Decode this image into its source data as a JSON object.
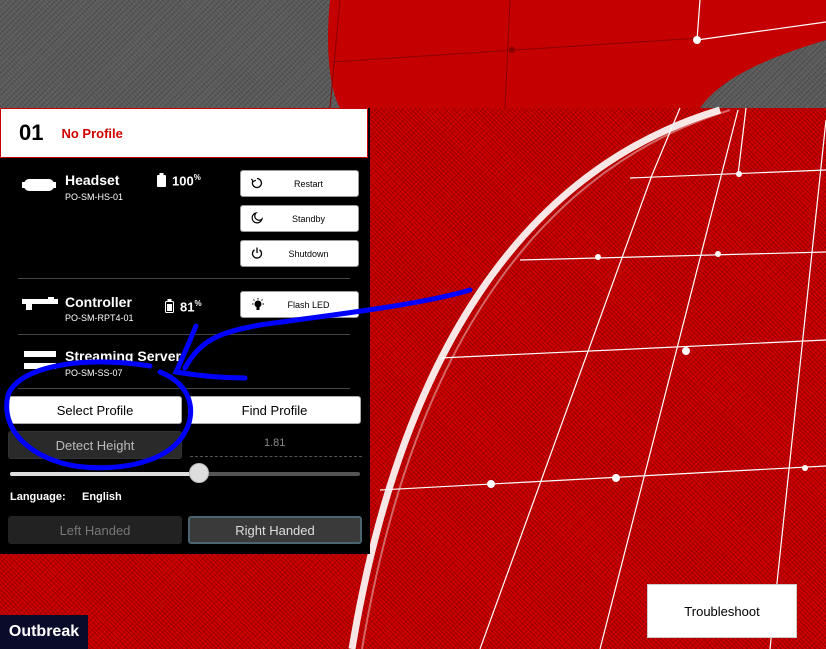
{
  "profile": {
    "number": "01",
    "name": "No Profile"
  },
  "devices": {
    "headset": {
      "name": "Headset",
      "id": "PO-SM-HS-01",
      "battery": "100",
      "battery_unit": "%"
    },
    "controller": {
      "name": "Controller",
      "id": "PO-SM-RPT4-01",
      "battery": "81",
      "battery_unit": "%"
    },
    "server": {
      "name": "Streaming Server",
      "id": "PO-SM-SS-07"
    }
  },
  "headset_actions": {
    "restart": "Restart",
    "standby": "Standby",
    "shutdown": "Shutdown"
  },
  "controller_actions": {
    "flash_led": "Flash LED"
  },
  "profile_actions": {
    "select": "Select Profile",
    "find": "Find Profile"
  },
  "height": {
    "detect_label": "Detect Height",
    "value": "1.81",
    "slider_fraction": 0.54
  },
  "language": {
    "label": "Language:",
    "value": "English"
  },
  "handedness": {
    "left": "Left Handed",
    "right": "Right Handed",
    "selected": "right"
  },
  "troubleshoot_label": "Troubleshoot",
  "brand": "Outbreak",
  "colors": {
    "accent_red": "#d00000",
    "panel_bg": "#000000",
    "annotation_blue": "#0000ff"
  }
}
